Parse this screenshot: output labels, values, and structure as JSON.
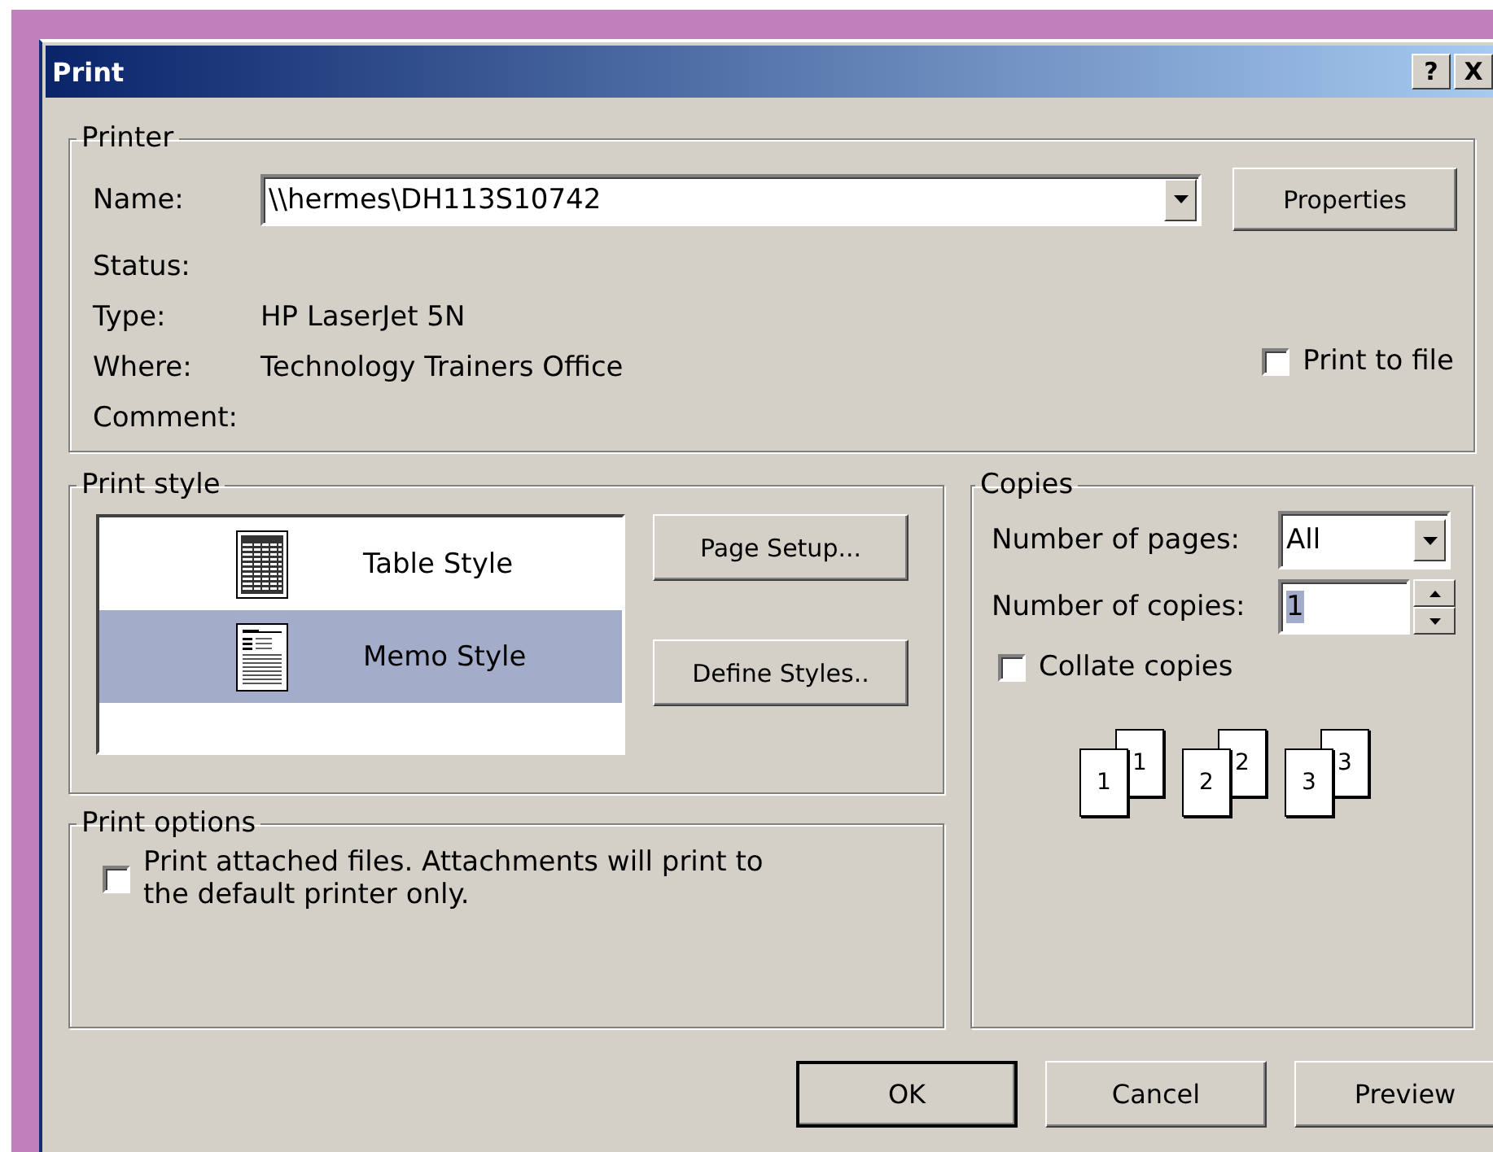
{
  "window": {
    "title": "Print",
    "title_buttons": [
      "?",
      "X"
    ]
  },
  "printer": {
    "label": "Printer",
    "name_label": "Name:",
    "name_value": "\\\\hermes\\DH113S10742",
    "properties_button": "Properties",
    "fields": [
      {
        "label": "Status:"
      },
      {
        "label": "Type:",
        "value": "HP LaserJet 5N"
      },
      {
        "label": "Where:",
        "value": "Technology Trainers Office"
      },
      {
        "label": "Comment:"
      }
    ],
    "print_to_file": {
      "label": "Print to file",
      "checked": false
    }
  },
  "print_style": {
    "label": "Print style",
    "items": [
      {
        "label": "Table Style",
        "kind": "table",
        "selected": false
      },
      {
        "label": "Memo Style",
        "kind": "memo",
        "selected": true
      }
    ],
    "buttons": [
      "Page Setup...",
      "Define Styles.."
    ]
  },
  "print_options": {
    "label": "Print options",
    "attachments": {
      "label": "Print attached files.  Attachments will print to the default printer only.",
      "checked": false
    }
  },
  "copies": {
    "label": "Copies",
    "pages_label": "Number of pages:",
    "pages_value": "All",
    "copies_label": "Number of copies:",
    "copies_value": "1",
    "copies_value_highlighted": true,
    "collate": {
      "label": "Collate copies",
      "checked": false
    },
    "stacks": [
      {
        "back": "1",
        "front": "1"
      },
      {
        "back": "2",
        "front": "2"
      },
      {
        "back": "3",
        "front": "3"
      }
    ]
  },
  "buttons": [
    {
      "label": "OK",
      "default": true
    },
    {
      "label": "Cancel",
      "default": false
    },
    {
      "label": "Preview",
      "default": false
    }
  ]
}
